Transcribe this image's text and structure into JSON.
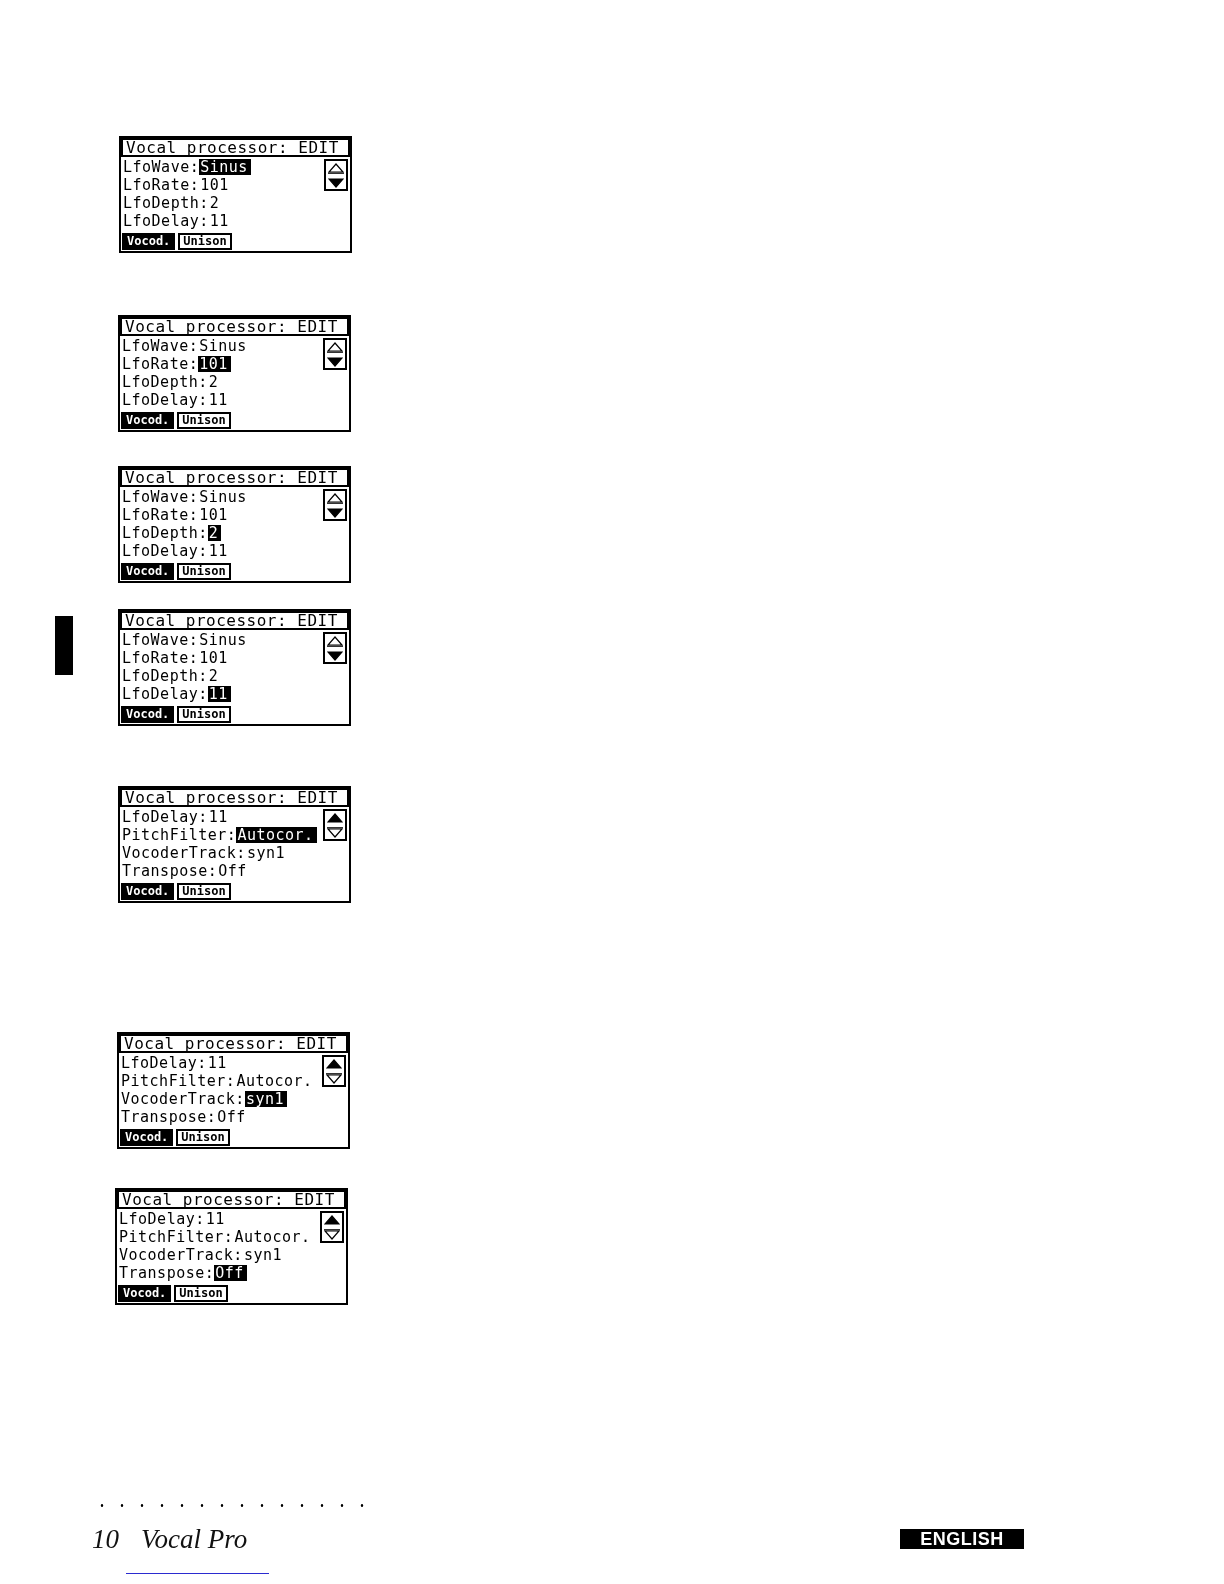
{
  "screens": [
    {
      "title": "Vocal processor: EDIT",
      "params": [
        {
          "label": "LfoWave:",
          "value": "Sinus",
          "selected": true
        },
        {
          "label": "LfoRate:",
          "value": "101",
          "selected": false
        },
        {
          "label": "LfoDepth:",
          "value": "2",
          "selected": false
        },
        {
          "label": "LfoDelay:",
          "value": "11",
          "selected": false
        }
      ],
      "scroll": {
        "up_filled": false,
        "down_filled": true
      },
      "tabs": [
        {
          "label": "Vocod.",
          "selected": true
        },
        {
          "label": "Unison",
          "selected": false
        }
      ]
    },
    {
      "title": "Vocal processor: EDIT",
      "params": [
        {
          "label": "LfoWave:",
          "value": "Sinus",
          "selected": false
        },
        {
          "label": "LfoRate:",
          "value": "101",
          "selected": true
        },
        {
          "label": "LfoDepth:",
          "value": "2",
          "selected": false
        },
        {
          "label": "LfoDelay:",
          "value": "11",
          "selected": false
        }
      ],
      "scroll": {
        "up_filled": false,
        "down_filled": true
      },
      "tabs": [
        {
          "label": "Vocod.",
          "selected": true
        },
        {
          "label": "Unison",
          "selected": false
        }
      ]
    },
    {
      "title": "Vocal processor: EDIT",
      "params": [
        {
          "label": "LfoWave:",
          "value": "Sinus",
          "selected": false
        },
        {
          "label": "LfoRate:",
          "value": "101",
          "selected": false
        },
        {
          "label": "LfoDepth:",
          "value": "2",
          "selected": true
        },
        {
          "label": "LfoDelay:",
          "value": "11",
          "selected": false
        }
      ],
      "scroll": {
        "up_filled": false,
        "down_filled": true
      },
      "tabs": [
        {
          "label": "Vocod.",
          "selected": true
        },
        {
          "label": "Unison",
          "selected": false
        }
      ]
    },
    {
      "title": "Vocal processor: EDIT",
      "params": [
        {
          "label": "LfoWave:",
          "value": "Sinus",
          "selected": false
        },
        {
          "label": "LfoRate:",
          "value": "101",
          "selected": false
        },
        {
          "label": "LfoDepth:",
          "value": "2",
          "selected": false
        },
        {
          "label": "LfoDelay:",
          "value": "11",
          "selected": true
        }
      ],
      "scroll": {
        "up_filled": false,
        "down_filled": true
      },
      "tabs": [
        {
          "label": "Vocod.",
          "selected": true
        },
        {
          "label": "Unison",
          "selected": false
        }
      ]
    },
    {
      "title": "Vocal processor: EDIT",
      "params": [
        {
          "label": "LfoDelay:",
          "value": "11",
          "selected": false
        },
        {
          "label": "PitchFilter:",
          "value": "Autocor.",
          "selected": true
        },
        {
          "label": "VocoderTrack:",
          "value": "syn1",
          "selected": false
        },
        {
          "label": "Transpose:",
          "value": "Off",
          "selected": false
        }
      ],
      "scroll": {
        "up_filled": true,
        "down_filled": false
      },
      "tabs": [
        {
          "label": "Vocod.",
          "selected": true
        },
        {
          "label": "Unison",
          "selected": false
        }
      ]
    },
    {
      "title": "Vocal processor: EDIT",
      "params": [
        {
          "label": "LfoDelay:",
          "value": "11",
          "selected": false
        },
        {
          "label": "PitchFilter:",
          "value": "Autocor.",
          "selected": false
        },
        {
          "label": "VocoderTrack:",
          "value": "syn1",
          "selected": true
        },
        {
          "label": "Transpose:",
          "value": "Off",
          "selected": false
        }
      ],
      "scroll": {
        "up_filled": true,
        "down_filled": false
      },
      "tabs": [
        {
          "label": "Vocod.",
          "selected": true
        },
        {
          "label": "Unison",
          "selected": false
        }
      ]
    },
    {
      "title": "Vocal processor: EDIT",
      "params": [
        {
          "label": "LfoDelay:",
          "value": "11",
          "selected": false
        },
        {
          "label": "PitchFilter:",
          "value": "Autocor.",
          "selected": false
        },
        {
          "label": "VocoderTrack:",
          "value": "syn1",
          "selected": false
        },
        {
          "label": "Transpose:",
          "value": "Off",
          "selected": true
        }
      ],
      "scroll": {
        "up_filled": true,
        "down_filled": false
      },
      "tabs": [
        {
          "label": "Vocod.",
          "selected": true
        },
        {
          "label": "Unison",
          "selected": false
        }
      ]
    }
  ],
  "footer": {
    "page_number": "10",
    "title": "Vocal Pro",
    "language": "ENGLISH"
  }
}
